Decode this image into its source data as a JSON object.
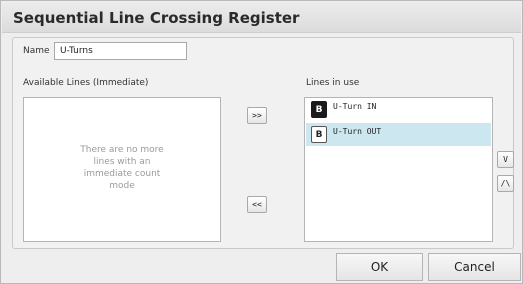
{
  "dialog": {
    "title": "Sequential Line Crossing Register"
  },
  "name_field": {
    "label": "Name",
    "value": "U-Turns"
  },
  "available": {
    "header": "Available Lines (Immediate)",
    "empty_message": "There are no more lines with an immediate count mode"
  },
  "in_use": {
    "header": "Lines in use",
    "items": [
      {
        "badge": "B",
        "name": "U-Turn IN",
        "badge_style": "dark",
        "selected": false
      },
      {
        "badge": "B",
        "name": "U-Turn OUT",
        "badge_style": "light",
        "selected": true
      }
    ]
  },
  "buttons": {
    "add": ">>",
    "remove": "<<",
    "move_down": "V",
    "move_up": "/\\",
    "ok": "OK",
    "cancel": "Cancel"
  }
}
